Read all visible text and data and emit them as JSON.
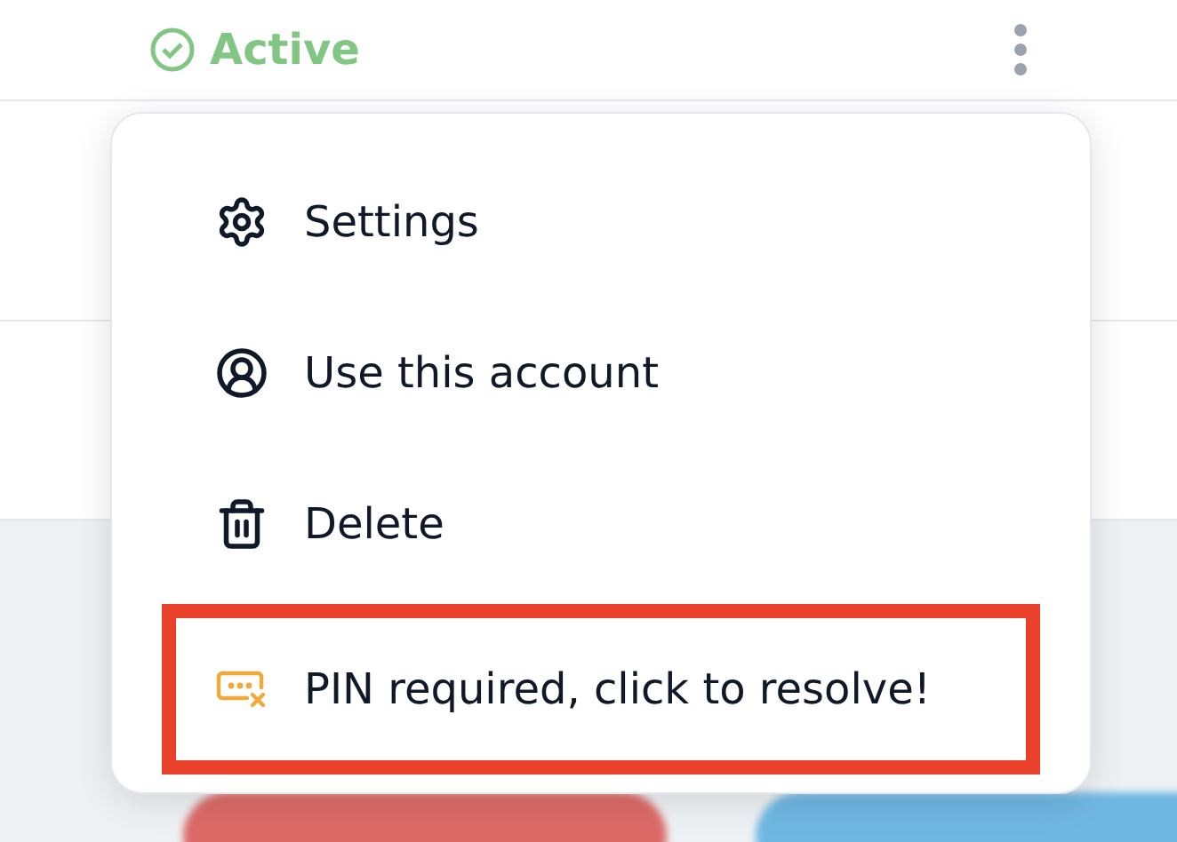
{
  "status": {
    "label": "Active"
  },
  "menu": {
    "items": [
      {
        "kind": "settings",
        "label": "Settings",
        "highlighted": false
      },
      {
        "kind": "account",
        "label": "Use this account",
        "highlighted": false
      },
      {
        "kind": "delete",
        "label": "Delete",
        "highlighted": false
      },
      {
        "kind": "pin",
        "label": "PIN required, click to resolve!",
        "highlighted": true
      }
    ]
  }
}
